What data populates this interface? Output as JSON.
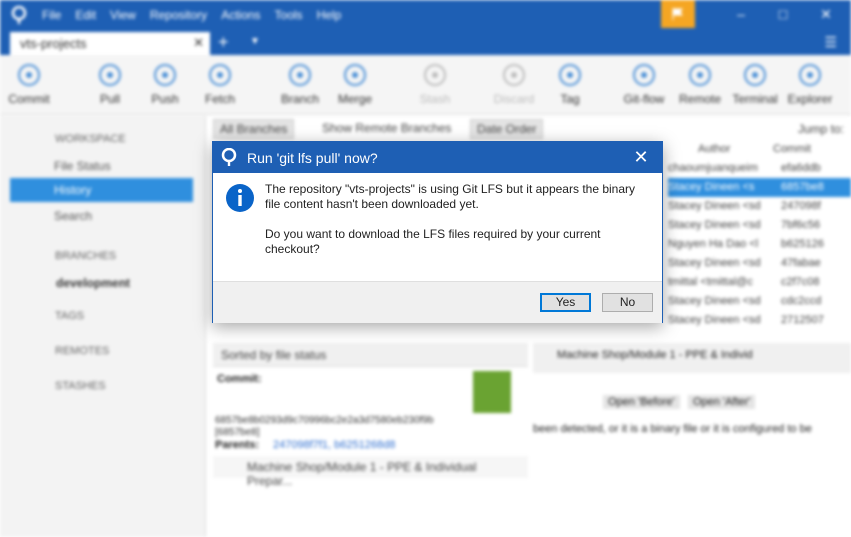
{
  "app": {
    "menu": [
      "File",
      "Edit",
      "View",
      "Repository",
      "Actions",
      "Tools",
      "Help"
    ],
    "tab": "vts-projects",
    "toolbar": [
      {
        "label": "Commit",
        "icon": "commit-icon"
      },
      {
        "label": "Pull",
        "icon": "pull-icon"
      },
      {
        "label": "Push",
        "icon": "push-icon"
      },
      {
        "label": "Fetch",
        "icon": "fetch-icon"
      },
      {
        "label": "Branch",
        "icon": "branch-icon"
      },
      {
        "label": "Merge",
        "icon": "merge-icon"
      },
      {
        "label": "Stash",
        "icon": "stash-icon"
      },
      {
        "label": "Discard",
        "icon": "discard-icon"
      },
      {
        "label": "Tag",
        "icon": "tag-icon"
      },
      {
        "label": "Git-flow",
        "icon": "gitflow-icon"
      },
      {
        "label": "Remote",
        "icon": "remote-icon"
      },
      {
        "label": "Terminal",
        "icon": "terminal-icon"
      },
      {
        "label": "Explorer",
        "icon": "explorer-icon"
      }
    ],
    "sidebar": {
      "workspace": "WORKSPACE",
      "file_status": "File Status",
      "history": "History",
      "search": "Search",
      "branches": "BRANCHES",
      "branch_dev": "development",
      "tags": "TAGS",
      "remotes": "REMOTES",
      "stashes": "STASHES"
    },
    "filters": {
      "branches": "All Branches",
      "show_remote": "Show Remote Branches",
      "order": "Date Order",
      "jump": "Jump to:"
    },
    "columns": {
      "author": "Author",
      "commit": "Commit"
    },
    "rows": [
      {
        "author": "chaoumjuanqueim",
        "commit": "efa6ddb"
      },
      {
        "author": "Stacey Dineen <s",
        "commit": "6857be8"
      },
      {
        "author": "Stacey Dineen <sd",
        "commit": "247098f"
      },
      {
        "author": "Stacey Dineen <sd",
        "commit": "7bf6c56"
      },
      {
        "author": "Nguyen Ha Dao <l",
        "commit": "b625126"
      },
      {
        "author": "Stacey Dineen <sd",
        "commit": "47fabae"
      },
      {
        "author": "tmittal <tmittal@c",
        "commit": "c2f7c08"
      },
      {
        "author": "Stacey Dineen <sd",
        "commit": "cdc2ccd"
      },
      {
        "author": "Stacey Dineen <sd",
        "commit": "2712507"
      }
    ],
    "lower": {
      "sort": "Sorted by file status",
      "commit_label": "Commit:",
      "commit_hash": "6857be8b0293d9c70996bc2e2a3d7580eb230f9b",
      "commit_short": "[6857be8]",
      "parents_label": "Parents:",
      "parents": "247098f7f1, b6251268d8",
      "file": "Machine Shop/Module 1 - PPE & Individual Prepar...",
      "right_file": "Machine Shop/Module 1 - PPE & Individ",
      "open_before": "Open 'Before'",
      "open_after": "Open 'After'",
      "binary_msg": "been detected, or it is a binary file or it is configured to be"
    }
  },
  "dialog": {
    "title": "Run 'git lfs pull' now?",
    "message1": "The repository \"vts-projects\" is using Git LFS but it appears the binary file content hasn't been downloaded yet.",
    "message2": "Do you want to download the LFS files required by your current checkout?",
    "yes": "Yes",
    "no": "No"
  },
  "colors": {
    "brand": "#1e5fb4",
    "accent": "#2f8fde",
    "flag": "#f5a623",
    "info": "#0a64c8"
  }
}
